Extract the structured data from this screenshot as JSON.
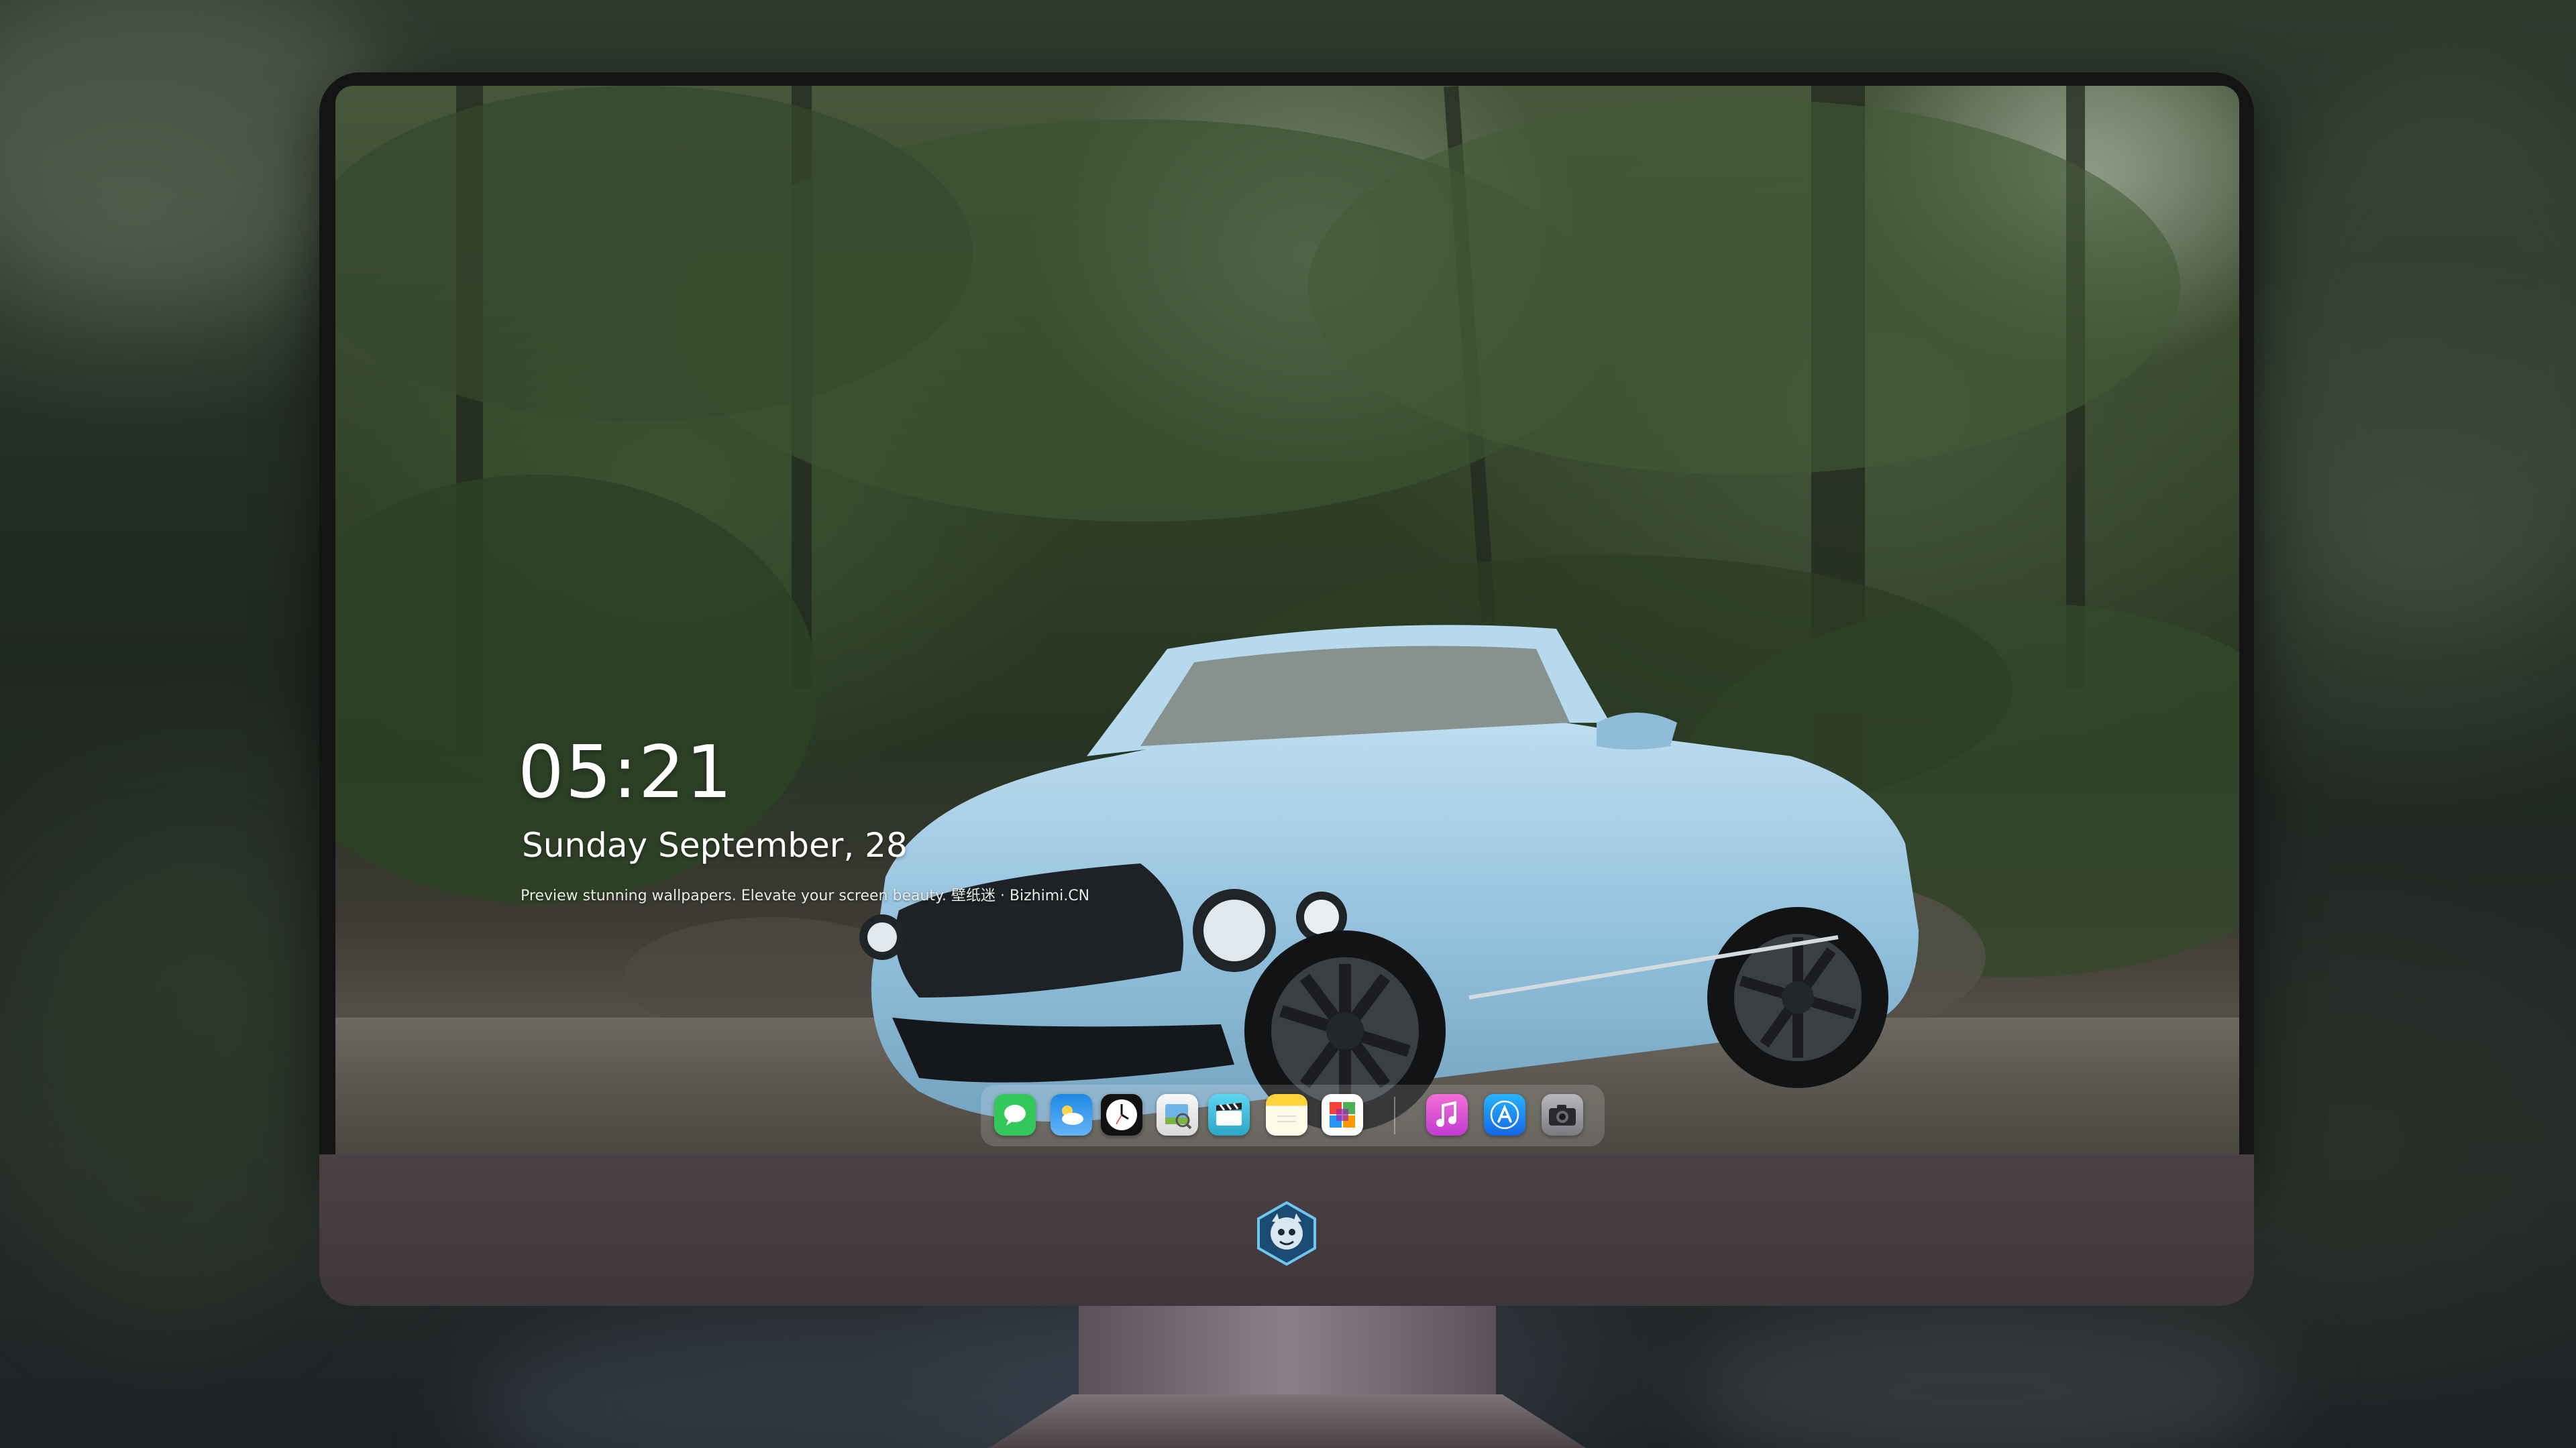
{
  "lock_screen": {
    "time": "05:21",
    "date": "Sunday September, 28",
    "tagline": "Preview stunning wallpapers. Elevate your screen beauty. 壁纸迷 · Bizhimi.CN"
  },
  "dock": {
    "apps": [
      {
        "name": "Messages",
        "icon": "messages-icon",
        "color": "#34c759"
      },
      {
        "name": "Weather",
        "icon": "weather-icon",
        "color": "#1e88e5"
      },
      {
        "name": "Clock",
        "icon": "clock-icon",
        "color": "#111111"
      },
      {
        "name": "Preview",
        "icon": "preview-icon",
        "color": "#f2f2f2"
      },
      {
        "name": "Clips",
        "icon": "clips-icon",
        "color": "#3ec1e0"
      },
      {
        "name": "Notes",
        "icon": "notes-icon",
        "color": "#ffd33c"
      },
      {
        "name": "Photos",
        "icon": "photos-icon",
        "color": "#ffffff"
      },
      {
        "name": "Music",
        "icon": "music-icon",
        "color": "#e94bd0"
      },
      {
        "name": "App Store",
        "icon": "app-store-icon",
        "color": "#1a8cff"
      },
      {
        "name": "Camera",
        "icon": "camera-icon",
        "color": "#8e8e93"
      }
    ]
  },
  "monitor": {
    "logo_icon": "mascot-logo-icon"
  },
  "wallpaper": {
    "subject": "light blue convertible car in forest",
    "car_color": "#9ecbe6"
  }
}
